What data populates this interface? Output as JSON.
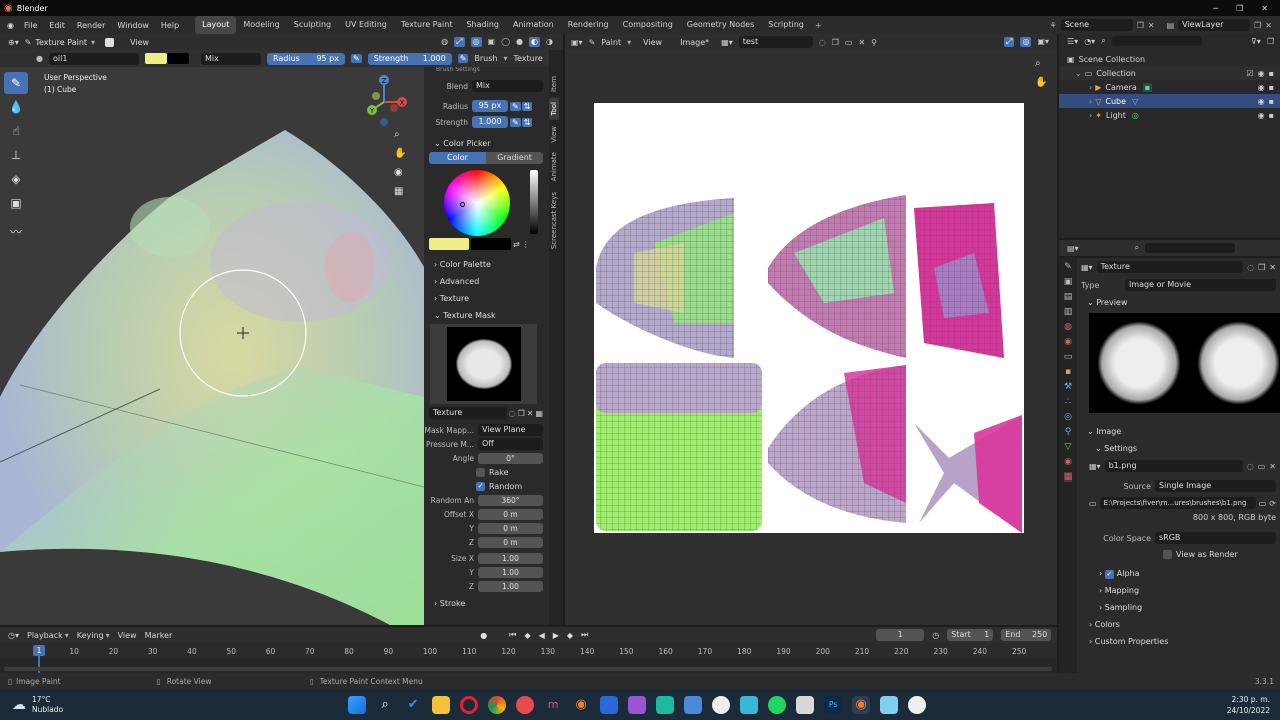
{
  "app": {
    "title": "Blender"
  },
  "menu": [
    "File",
    "Edit",
    "Render",
    "Window",
    "Help"
  ],
  "workspaces": [
    "Layout",
    "Modeling",
    "Sculpting",
    "UV Editing",
    "Texture Paint",
    "Shading",
    "Animation",
    "Rendering",
    "Compositing",
    "Geometry Nodes",
    "Scripting"
  ],
  "active_workspace": "Layout",
  "scene": "Scene",
  "view_layer": "ViewLayer",
  "viewport_header": {
    "mode": "Texture Paint",
    "view": "View"
  },
  "tool_header": {
    "brush_name": "oil1",
    "blend": "Mix",
    "radius_label": "Radius",
    "radius": "95 px",
    "strength_label": "Strength",
    "strength": "1.000",
    "brush": "Brush",
    "texture": "Texture",
    "te": "Te"
  },
  "viewport": {
    "line1": "User Perspective",
    "line2": "(1) Cube"
  },
  "panel": {
    "brush_settings": "Brush Settings",
    "blend_label": "Blend",
    "blend": "Mix",
    "radius_label": "Radius",
    "radius": "95 px",
    "strength_label": "Strength",
    "strength": "1.000",
    "color_picker": "Color Picker",
    "tab_color": "Color",
    "tab_gradient": "Gradient",
    "color_palette": "Color Palette",
    "advanced": "Advanced",
    "texture": "Texture",
    "texture_mask": "Texture Mask",
    "mask_texture_name": "Texture",
    "mask_mapping_label": "Mask Mapp...",
    "mask_mapping": "View Plane",
    "pressure_label": "Pressure M...",
    "pressure": "Off",
    "angle_label": "Angle",
    "angle": "0°",
    "rake": "Rake",
    "random": "Random",
    "random_angle_label": "Random An",
    "random_angle": "360°",
    "offset_x_label": "Offset X",
    "offset_x": "0 m",
    "y_label": "Y",
    "offset_y": "0 m",
    "z_label": "Z",
    "offset_z": "0 m",
    "size_x_label": "Size X",
    "size_x": "1.00",
    "size_y": "1.00",
    "size_z": "1.00",
    "stroke": "Stroke"
  },
  "side_tabs": [
    "Item",
    "Tool",
    "View",
    "Animate",
    "Screencast Keys"
  ],
  "uv_header": {
    "mode": "Paint",
    "view": "View",
    "image": "Image*",
    "image_name": "test"
  },
  "outliner": {
    "root": "Scene Collection",
    "collection": "Collection",
    "items": [
      "Camera",
      "Cube",
      "Light"
    ]
  },
  "properties": {
    "texture_name": "Texture",
    "type_label": "Type",
    "type": "Image or Movie",
    "preview": "Preview",
    "image_section": "Image",
    "settings": "Settings",
    "image_file": "b1.png",
    "source_label": "Source",
    "source": "Single Image",
    "filepath": "E:\\Projects\\fiver\\m...ures\\brushes\\b1.png",
    "resolution": "800 x 800,  RGB byte",
    "color_space_label": "Color Space",
    "color_space": "sRGB",
    "view_as_render": "View as Render",
    "alpha": "Alpha",
    "mapping": "Mapping",
    "sampling": "Sampling",
    "colors": "Colors",
    "custom_props": "Custom Properties"
  },
  "timeline": {
    "playback": "Playback",
    "keying": "Keying",
    "view": "View",
    "marker": "Marker",
    "current_frame": "1",
    "start_label": "Start",
    "start": "1",
    "end_label": "End",
    "end": "250",
    "ticks": [
      "1",
      "10",
      "20",
      "30",
      "40",
      "50",
      "60",
      "70",
      "80",
      "90",
      "100",
      "110",
      "120",
      "130",
      "140",
      "150",
      "160",
      "170",
      "180",
      "190",
      "200",
      "210",
      "220",
      "230",
      "240",
      "250"
    ]
  },
  "status": {
    "left": "Image Paint",
    "mid": "Rotate View",
    "right": "Texture Paint Context Menu",
    "version": "3.3.1"
  },
  "taskbar": {
    "temp": "17°C",
    "weather": "Nublado",
    "time": "2:30 p. m.",
    "date": "24/10/2022"
  },
  "colors": {
    "accent": "#4772b3",
    "primary_color": "#eeee88",
    "header": "#2e2e2e"
  }
}
